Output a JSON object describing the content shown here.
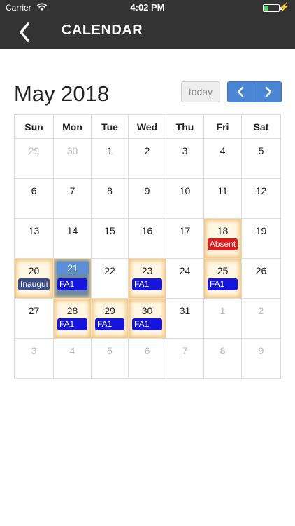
{
  "status_bar": {
    "carrier": "Carrier",
    "time": "4:02 PM",
    "charging": "⚡"
  },
  "nav": {
    "title": "CALENDAR"
  },
  "calendar": {
    "month_title": "May 2018",
    "today_label": "today",
    "days_of_week": [
      "Sun",
      "Mon",
      "Tue",
      "Wed",
      "Thu",
      "Fri",
      "Sat"
    ],
    "weeks": [
      [
        {
          "day": "29",
          "other": true
        },
        {
          "day": "30",
          "other": true
        },
        {
          "day": "1"
        },
        {
          "day": "2"
        },
        {
          "day": "3"
        },
        {
          "day": "4"
        },
        {
          "day": "5"
        }
      ],
      [
        {
          "day": "6"
        },
        {
          "day": "7"
        },
        {
          "day": "8"
        },
        {
          "day": "9"
        },
        {
          "day": "10"
        },
        {
          "day": "11"
        },
        {
          "day": "12"
        }
      ],
      [
        {
          "day": "13"
        },
        {
          "day": "14"
        },
        {
          "day": "15"
        },
        {
          "day": "16"
        },
        {
          "day": "17"
        },
        {
          "day": "18",
          "highlight": true,
          "event": "Absent",
          "event_type": "absent"
        },
        {
          "day": "19"
        }
      ],
      [
        {
          "day": "20",
          "highlight": true,
          "event": "Inaugui",
          "event_type": "inaug"
        },
        {
          "day": "21",
          "selected": true,
          "event": "FA1",
          "event_type": "fa"
        },
        {
          "day": "22"
        },
        {
          "day": "23",
          "highlight": true,
          "event": "FA1",
          "event_type": "fa"
        },
        {
          "day": "24"
        },
        {
          "day": "25",
          "highlight": true,
          "event": "FA1",
          "event_type": "fa"
        },
        {
          "day": "26"
        }
      ],
      [
        {
          "day": "27"
        },
        {
          "day": "28",
          "highlight": true,
          "event": "FA1",
          "event_type": "fa"
        },
        {
          "day": "29",
          "highlight": true,
          "event": "FA1",
          "event_type": "fa"
        },
        {
          "day": "30",
          "highlight": true,
          "event": "FA1",
          "event_type": "fa"
        },
        {
          "day": "31"
        },
        {
          "day": "1",
          "other": true
        },
        {
          "day": "2",
          "other": true
        }
      ],
      [
        {
          "day": "3",
          "other": true
        },
        {
          "day": "4",
          "other": true
        },
        {
          "day": "5",
          "other": true
        },
        {
          "day": "6",
          "other": true
        },
        {
          "day": "7",
          "other": true
        },
        {
          "day": "8",
          "other": true
        },
        {
          "day": "9",
          "other": true
        }
      ]
    ]
  },
  "colors": {
    "nav_bg": "#333333",
    "accent": "#4a86d4",
    "event_blue": "#1515dd",
    "event_red": "#dd1a1a",
    "highlight": "#f2c47a"
  }
}
